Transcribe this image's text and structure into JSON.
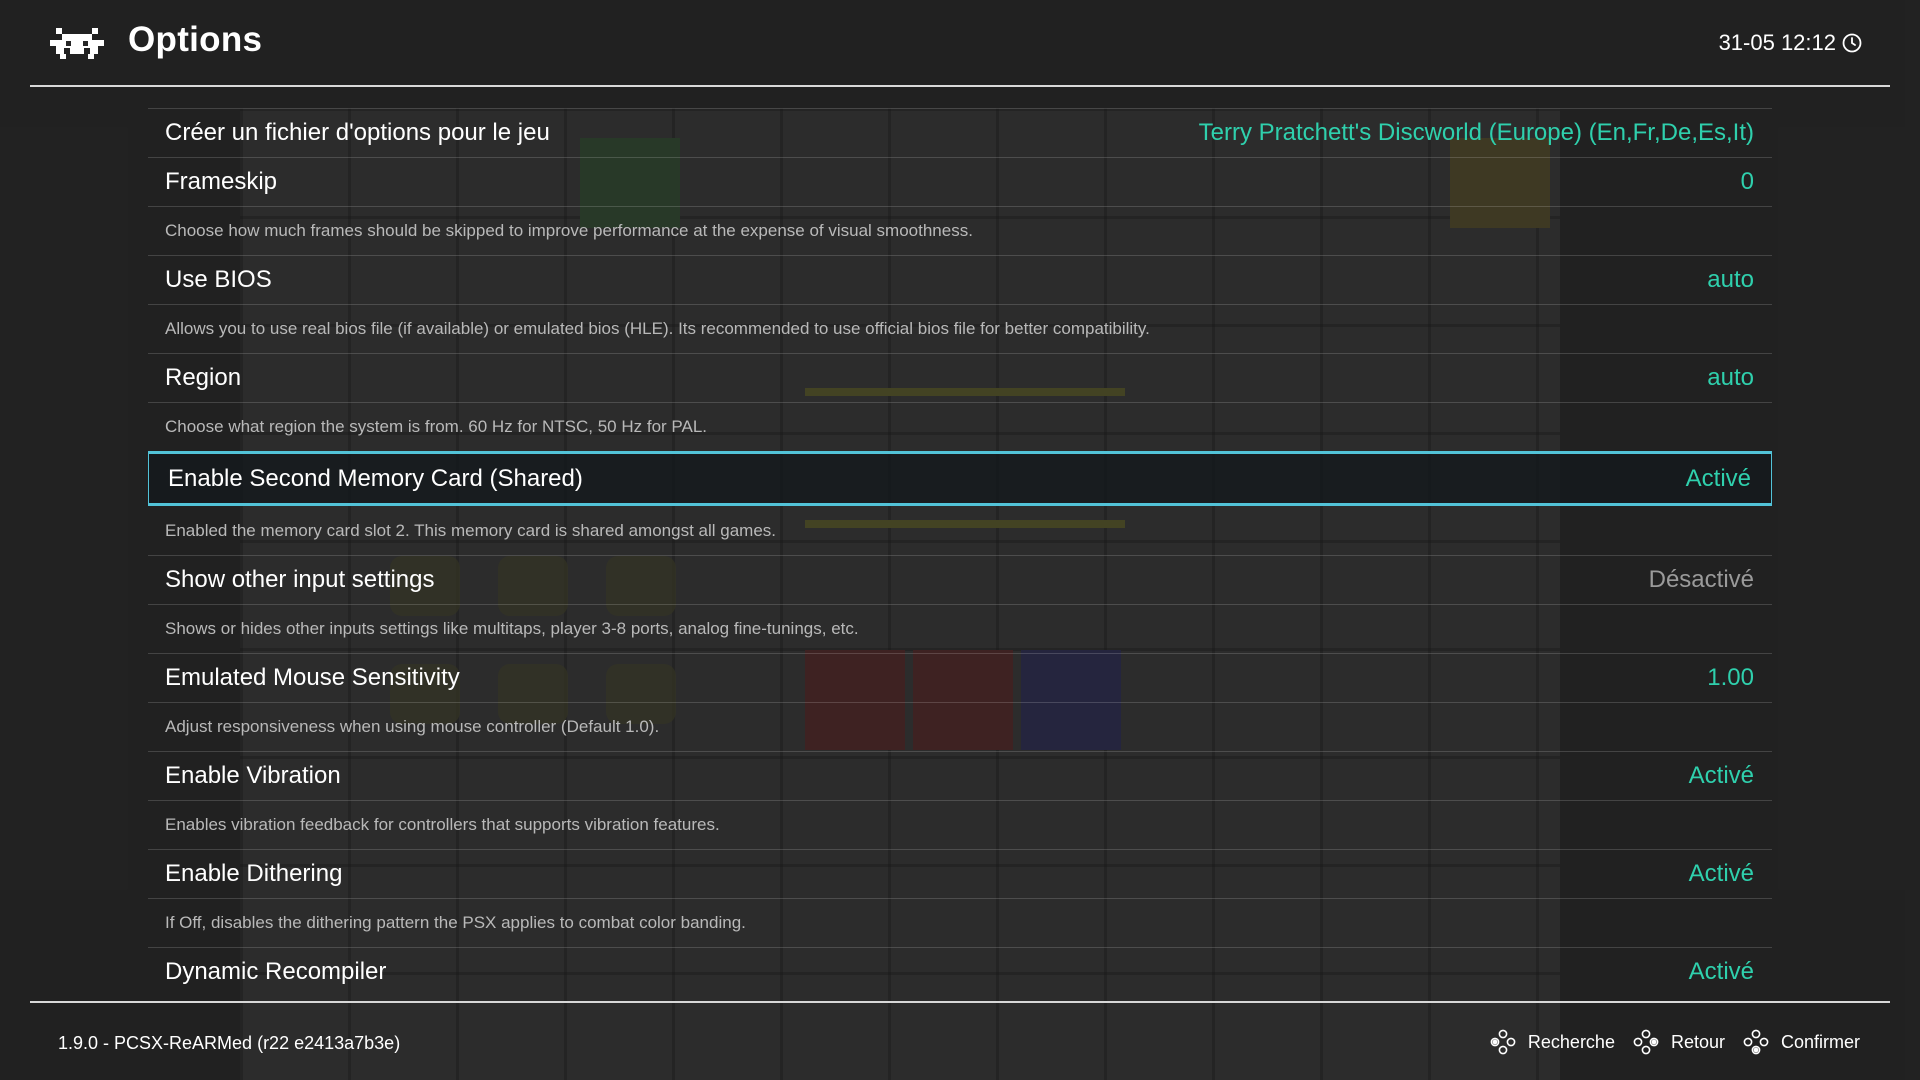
{
  "header": {
    "title": "Options",
    "datetime": "31-05 12:12",
    "logo_icon": "retroarch-invader-icon",
    "clock_icon": "clock-icon"
  },
  "options": [
    {
      "label": "Créer un fichier d'options pour le jeu",
      "value": "Terry Pratchett's Discworld (Europe) (En,Fr,De,Es,It)",
      "description": ""
    },
    {
      "label": "Frameskip",
      "value": "0",
      "description": "Choose how much frames should be skipped to improve performance at the expense of visual smoothness."
    },
    {
      "label": "Use BIOS",
      "value": "auto",
      "description": "Allows you to use real bios file (if available) or emulated bios (HLE). Its recommended to use official bios file for better compatibility."
    },
    {
      "label": "Region",
      "value": "auto",
      "description": "Choose what region the system is from. 60 Hz for NTSC, 50 Hz for PAL."
    },
    {
      "label": "Enable Second Memory Card (Shared)",
      "value": "Activé",
      "description": "Enabled the memory card slot 2. This memory card is shared amongst all games."
    },
    {
      "label": "Show other input settings",
      "value": "Désactivé",
      "description": "Shows or hides other inputs settings like multitaps, player 3-8 ports, analog fine-tunings, etc."
    },
    {
      "label": "Emulated Mouse Sensitivity",
      "value": "1.00",
      "description": "Adjust responsiveness when using mouse controller (Default 1.0)."
    },
    {
      "label": "Enable Vibration",
      "value": "Activé",
      "description": "Enables vibration feedback for controllers that supports vibration features."
    },
    {
      "label": "Enable Dithering",
      "value": "Activé",
      "description": "If Off, disables the dithering pattern the PSX applies to combat color banding."
    },
    {
      "label": "Dynamic Recompiler",
      "value": "Activé",
      "description": ""
    }
  ],
  "footer": {
    "version": "1.9.0 - PCSX-ReARMed (r22 e2413a7b3e)",
    "hints": {
      "search": "Recherche",
      "back": "Retour",
      "confirm": "Confirmer"
    },
    "hint_icon": "dpad-icon"
  },
  "colors": {
    "accent": "#2fd0ad",
    "selection_border": "#52c3d8",
    "disabled_value": "#9a9a9a",
    "description": "#b9b9b9"
  }
}
